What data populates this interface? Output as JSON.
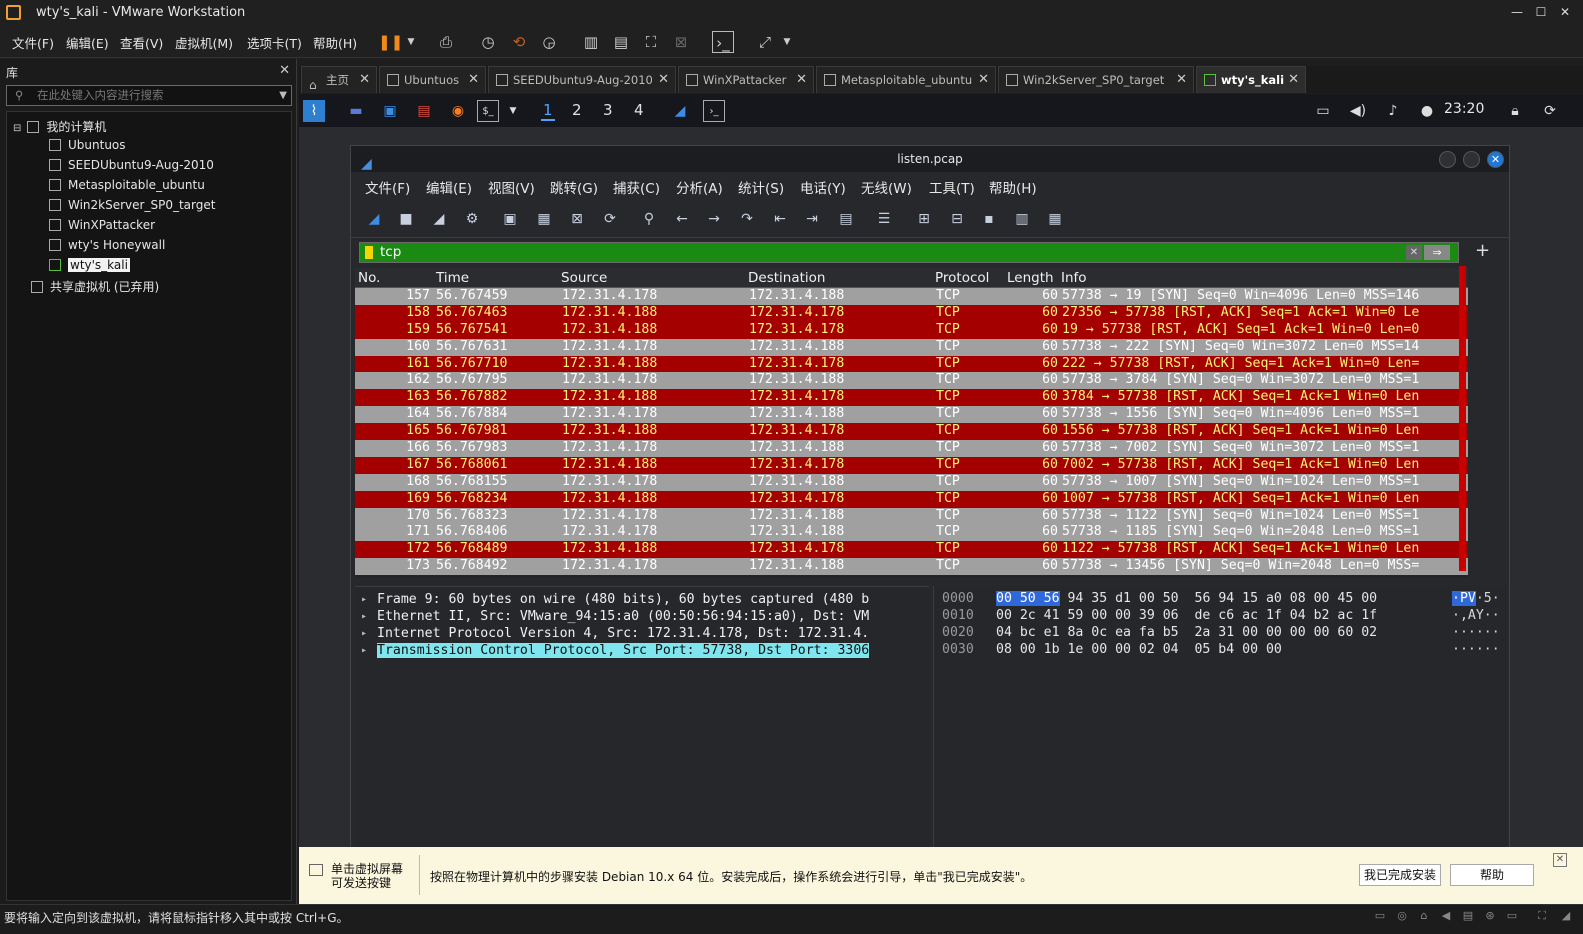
{
  "window": {
    "title": "wty's_kali - VMware Workstation"
  },
  "menubar": [
    "文件(F)",
    "编辑(E)",
    "查看(V)",
    "虚拟机(M)",
    "选项卡(T)",
    "帮助(H)"
  ],
  "library": {
    "title": "库",
    "search_placeholder": "在此处键入内容进行搜索",
    "root": "我的计算机",
    "items": [
      "Ubuntuos",
      "SEEDUbuntu9-Aug-2010",
      "Metasploitable_ubuntu",
      "Win2kServer_SP0_target",
      "WinXPattacker",
      "wty's Honeywall",
      "wty's_kali"
    ],
    "shared": "共享虚拟机 (已弃用)"
  },
  "tabs": [
    "主页",
    "Ubuntuos",
    "SEEDUbuntu9-Aug-2010",
    "WinXPattacker",
    "Metasploitable_ubuntu",
    "Win2kServer_SP0_target",
    "wty's_kali"
  ],
  "kali": {
    "workspaces": [
      "1",
      "2",
      "3",
      "4"
    ],
    "clock": "23:20"
  },
  "wireshark": {
    "title": "listen.pcap",
    "menus": [
      "文件(F)",
      "编辑(E)",
      "视图(V)",
      "跳转(G)",
      "捕获(C)",
      "分析(A)",
      "统计(S)",
      "电话(Y)",
      "无线(W)",
      "工具(T)",
      "帮助(H)"
    ],
    "filter": "tcp",
    "columns": [
      "No.",
      "Time",
      "Source",
      "Destination",
      "Protocol",
      "Length",
      "Info"
    ],
    "packets": [
      {
        "no": "157",
        "time": "56.767459",
        "src": "172.31.4.178",
        "dst": "172.31.4.188",
        "proto": "TCP",
        "len": "60",
        "info": "57738 → 19 [SYN] Seq=0 Win=4096 Len=0 MSS=146",
        "kind": "syn"
      },
      {
        "no": "158",
        "time": "56.767463",
        "src": "172.31.4.188",
        "dst": "172.31.4.178",
        "proto": "TCP",
        "len": "60",
        "info": "27356 → 57738 [RST, ACK] Seq=1 Ack=1 Win=0 Le",
        "kind": "rst"
      },
      {
        "no": "159",
        "time": "56.767541",
        "src": "172.31.4.188",
        "dst": "172.31.4.178",
        "proto": "TCP",
        "len": "60",
        "info": "19 → 57738 [RST, ACK] Seq=1 Ack=1 Win=0 Len=0",
        "kind": "rst"
      },
      {
        "no": "160",
        "time": "56.767631",
        "src": "172.31.4.178",
        "dst": "172.31.4.188",
        "proto": "TCP",
        "len": "60",
        "info": "57738 → 222 [SYN] Seq=0 Win=3072 Len=0 MSS=14",
        "kind": "syn"
      },
      {
        "no": "161",
        "time": "56.767710",
        "src": "172.31.4.188",
        "dst": "172.31.4.178",
        "proto": "TCP",
        "len": "60",
        "info": "222 → 57738 [RST, ACK] Seq=1 Ack=1 Win=0 Len=",
        "kind": "rst"
      },
      {
        "no": "162",
        "time": "56.767795",
        "src": "172.31.4.178",
        "dst": "172.31.4.188",
        "proto": "TCP",
        "len": "60",
        "info": "57738 → 3784 [SYN] Seq=0 Win=3072 Len=0 MSS=1",
        "kind": "syn"
      },
      {
        "no": "163",
        "time": "56.767882",
        "src": "172.31.4.188",
        "dst": "172.31.4.178",
        "proto": "TCP",
        "len": "60",
        "info": "3784 → 57738 [RST, ACK] Seq=1 Ack=1 Win=0 Len",
        "kind": "rst"
      },
      {
        "no": "164",
        "time": "56.767884",
        "src": "172.31.4.178",
        "dst": "172.31.4.188",
        "proto": "TCP",
        "len": "60",
        "info": "57738 → 1556 [SYN] Seq=0 Win=4096 Len=0 MSS=1",
        "kind": "syn"
      },
      {
        "no": "165",
        "time": "56.767981",
        "src": "172.31.4.188",
        "dst": "172.31.4.178",
        "proto": "TCP",
        "len": "60",
        "info": "1556 → 57738 [RST, ACK] Seq=1 Ack=1 Win=0 Len",
        "kind": "rst"
      },
      {
        "no": "166",
        "time": "56.767983",
        "src": "172.31.4.178",
        "dst": "172.31.4.188",
        "proto": "TCP",
        "len": "60",
        "info": "57738 → 7002 [SYN] Seq=0 Win=3072 Len=0 MSS=1",
        "kind": "syn"
      },
      {
        "no": "167",
        "time": "56.768061",
        "src": "172.31.4.188",
        "dst": "172.31.4.178",
        "proto": "TCP",
        "len": "60",
        "info": "7002 → 57738 [RST, ACK] Seq=1 Ack=1 Win=0 Len",
        "kind": "rst"
      },
      {
        "no": "168",
        "time": "56.768155",
        "src": "172.31.4.178",
        "dst": "172.31.4.188",
        "proto": "TCP",
        "len": "60",
        "info": "57738 → 1007 [SYN] Seq=0 Win=1024 Len=0 MSS=1",
        "kind": "syn"
      },
      {
        "no": "169",
        "time": "56.768234",
        "src": "172.31.4.188",
        "dst": "172.31.4.178",
        "proto": "TCP",
        "len": "60",
        "info": "1007 → 57738 [RST, ACK] Seq=1 Ack=1 Win=0 Len",
        "kind": "rst"
      },
      {
        "no": "170",
        "time": "56.768323",
        "src": "172.31.4.178",
        "dst": "172.31.4.188",
        "proto": "TCP",
        "len": "60",
        "info": "57738 → 1122 [SYN] Seq=0 Win=1024 Len=0 MSS=1",
        "kind": "syn"
      },
      {
        "no": "171",
        "time": "56.768406",
        "src": "172.31.4.178",
        "dst": "172.31.4.188",
        "proto": "TCP",
        "len": "60",
        "info": "57738 → 1185 [SYN] Seq=0 Win=2048 Len=0 MSS=1",
        "kind": "syn"
      },
      {
        "no": "172",
        "time": "56.768489",
        "src": "172.31.4.188",
        "dst": "172.31.4.178",
        "proto": "TCP",
        "len": "60",
        "info": "1122 → 57738 [RST, ACK] Seq=1 Ack=1 Win=0 Len",
        "kind": "rst"
      },
      {
        "no": "173",
        "time": "56.768492",
        "src": "172.31.4.178",
        "dst": "172.31.4.188",
        "proto": "TCP",
        "len": "60",
        "info": "57738 → 13456 [SYN] Seq=0 Win=2048 Len=0 MSS=",
        "kind": "syn"
      }
    ],
    "details": [
      "Frame 9: 60 bytes on wire (480 bits), 60 bytes captured (480 b",
      "Ethernet II, Src: VMware_94:15:a0 (00:50:56:94:15:a0), Dst: VM",
      "Internet Protocol Version 4, Src: 172.31.4.178, Dst: 172.31.4.",
      "Transmission Control Protocol, Src Port: 57738, Dst Port: 3306"
    ],
    "hex": [
      {
        "off": "0000",
        "sel": "00 50 56",
        "rest": " 94 35 d1 00 50  56 94 15 a0 08 00 45 00",
        "ascii_sel": "·PV",
        "ascii": "·5·"
      },
      {
        "off": "0010",
        "sel": "",
        "rest": "00 2c 41 59 00 00 39 06  de c6 ac 1f 04 b2 ac 1f",
        "ascii_sel": "",
        "ascii": "·,AY··"
      },
      {
        "off": "0020",
        "sel": "",
        "rest": "04 bc e1 8a 0c ea fa b5  2a 31 00 00 00 00 60 02",
        "ascii_sel": "",
        "ascii": "······"
      },
      {
        "off": "0030",
        "sel": "",
        "rest": "08 00 1b 1e 00 00 02 04  05 b4 00 00",
        "ascii_sel": "",
        "ascii": "······"
      }
    ]
  },
  "notice": {
    "left": "单击虚拟屏幕 可发送按键",
    "message": "按照在物理计算机中的步骤安装 Debian 10.x 64 位。安装完成后，操作系统会进行引导，单击\"我已完成安装\"。",
    "btn_done": "我已完成安装",
    "btn_help": "帮助"
  },
  "status": "要将输入定向到该虚拟机，请将鼠标指针移入其中或按 Ctrl+G。",
  "colors": {
    "rst_bg": "#a40000",
    "rst_fg": "#fff178",
    "syn_bg": "#a0a0a0",
    "filter_bg": "#1a8a12",
    "selection": "#7fe6ef"
  }
}
